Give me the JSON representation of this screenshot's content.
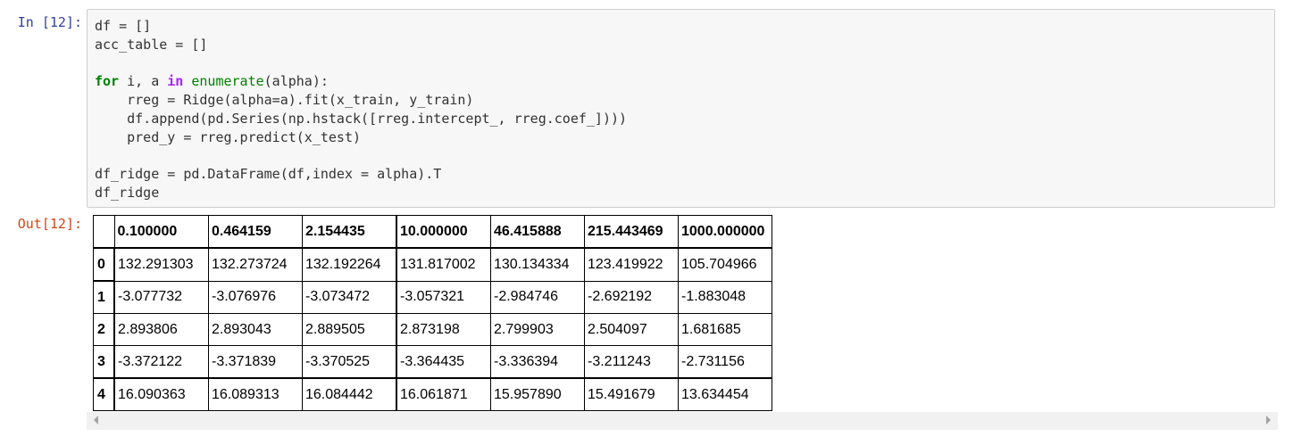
{
  "cell": {
    "in_prompt": "In [12]:",
    "out_prompt": "Out[12]:"
  },
  "code_lines": [
    "df = []",
    "acc_table = []",
    "",
    "for i, a in enumerate(alpha):",
    "    rreg = Ridge(alpha=a).fit(x_train, y_train)",
    "    df.append(pd.Series(np.hstack([rreg.intercept_, rreg.coef_])))",
    "    pred_y = rreg.predict(x_test)",
    "",
    "df_ridge = pd.DataFrame(df,index = alpha).T",
    "df_ridge"
  ],
  "table": {
    "columns": [
      "0.100000",
      "0.464159",
      "2.154435",
      "10.000000",
      "46.415888",
      "215.443469",
      "1000.000000"
    ],
    "rows": [
      {
        "index": "0",
        "values": [
          "132.291303",
          "132.273724",
          "132.192264",
          "131.817002",
          "130.134334",
          "123.419922",
          "105.704966"
        ]
      },
      {
        "index": "1",
        "values": [
          "-3.077732",
          "-3.076976",
          "-3.073472",
          "-3.057321",
          "-2.984746",
          "-2.692192",
          "-1.883048"
        ]
      },
      {
        "index": "2",
        "values": [
          "2.893806",
          "2.893043",
          "2.889505",
          "2.873198",
          "2.799903",
          "2.504097",
          "1.681685"
        ]
      },
      {
        "index": "3",
        "values": [
          "-3.372122",
          "-3.371839",
          "-3.370525",
          "-3.364435",
          "-3.336394",
          "-3.211243",
          "-2.731156"
        ]
      },
      {
        "index": "4",
        "values": [
          "16.090363",
          "16.089313",
          "16.084442",
          "16.061871",
          "15.957890",
          "15.491679",
          "13.634454"
        ]
      }
    ]
  },
  "icons": {
    "scroll_left": "scroll-left-arrow-icon",
    "scroll_right": "scroll-right-arrow-icon"
  }
}
